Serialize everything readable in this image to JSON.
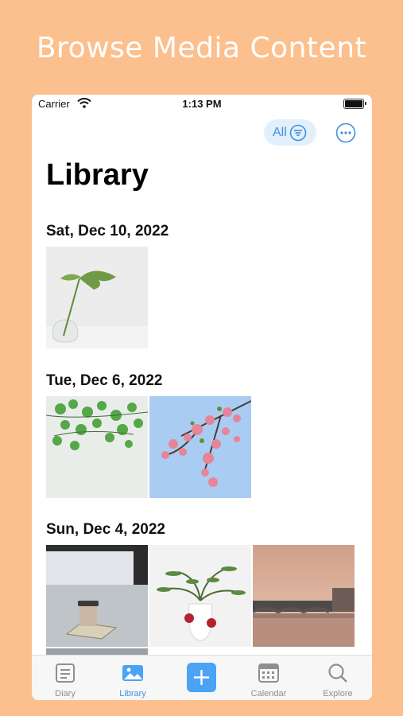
{
  "headline": "Browse Media Content",
  "status_bar": {
    "carrier": "Carrier",
    "time": "1:13 PM"
  },
  "toolbar": {
    "filter_label": "All"
  },
  "page_title": "Library",
  "sections": [
    {
      "date": "Sat, Dec 10, 2022"
    },
    {
      "date": "Tue, Dec 6, 2022"
    },
    {
      "date": "Sun, Dec 4, 2022"
    }
  ],
  "tabbar": {
    "tabs": [
      {
        "label": "Diary",
        "icon": "diary-icon"
      },
      {
        "label": "Library",
        "icon": "photo-icon",
        "active": true
      },
      {
        "label": "",
        "icon": "plus-icon"
      },
      {
        "label": "Calendar",
        "icon": "calendar-icon"
      },
      {
        "label": "Explore",
        "icon": "search-icon"
      }
    ]
  },
  "colors": {
    "background": "#FBC08D",
    "accent": "#3F8FE0",
    "pill": "#E3F0FB"
  }
}
